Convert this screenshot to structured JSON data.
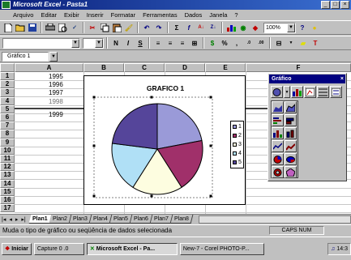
{
  "window": {
    "title": "Microsoft Excel - Pasta1"
  },
  "menu": [
    "Arquivo",
    "Editar",
    "Exibir",
    "Inserir",
    "Formatar",
    "Ferramentas",
    "Dados",
    "Janela",
    "?"
  ],
  "toolbar": {
    "zoom": "100%"
  },
  "format_toolbar": {
    "bold": "N",
    "italic": "I",
    "underline": "S"
  },
  "namebox": {
    "value": "Gráfico 1"
  },
  "columns": [
    "A",
    "B",
    "C",
    "D",
    "E",
    "F"
  ],
  "rows": [
    "1",
    "2",
    "3",
    "4",
    "5",
    "6",
    "7",
    "8",
    "9",
    "10",
    "11",
    "12",
    "13",
    "14",
    "15",
    "16",
    "17"
  ],
  "cells": {
    "a1": "1995",
    "a2": "1996",
    "a3": "1997",
    "a4": "1998",
    "a5": "1999"
  },
  "chart": {
    "title": "GRAFICO 1",
    "legend": [
      "1",
      "2",
      "3",
      "4",
      "5"
    ]
  },
  "chart_data": {
    "type": "pie",
    "title": "GRAFICO 1",
    "categories": [
      "1",
      "2",
      "3",
      "4",
      "5"
    ],
    "values": [
      22,
      19,
      18,
      18,
      23
    ],
    "colors": [
      "#9a9ad8",
      "#a0306a",
      "#fdfde0",
      "#b0e0f6",
      "#55459a"
    ],
    "legend_position": "right"
  },
  "palette": {
    "title": "Gráfico"
  },
  "sheet_tabs": [
    "Plan1",
    "Plan2",
    "Plan3",
    "Plan4",
    "Plan5",
    "Plan6",
    "Plan7",
    "Plan8"
  ],
  "status": {
    "message": "Muda o tipo de gráfico ou seqüência de dados selecionada",
    "caps": "CAPS",
    "num": "NUM"
  },
  "taskbar": {
    "start": "Iniciar",
    "items": [
      "Capture 0 .0",
      "Microsoft Excel - Pa...",
      "New-7 - Corel PHOTO-P..."
    ],
    "clock": "14:3"
  }
}
